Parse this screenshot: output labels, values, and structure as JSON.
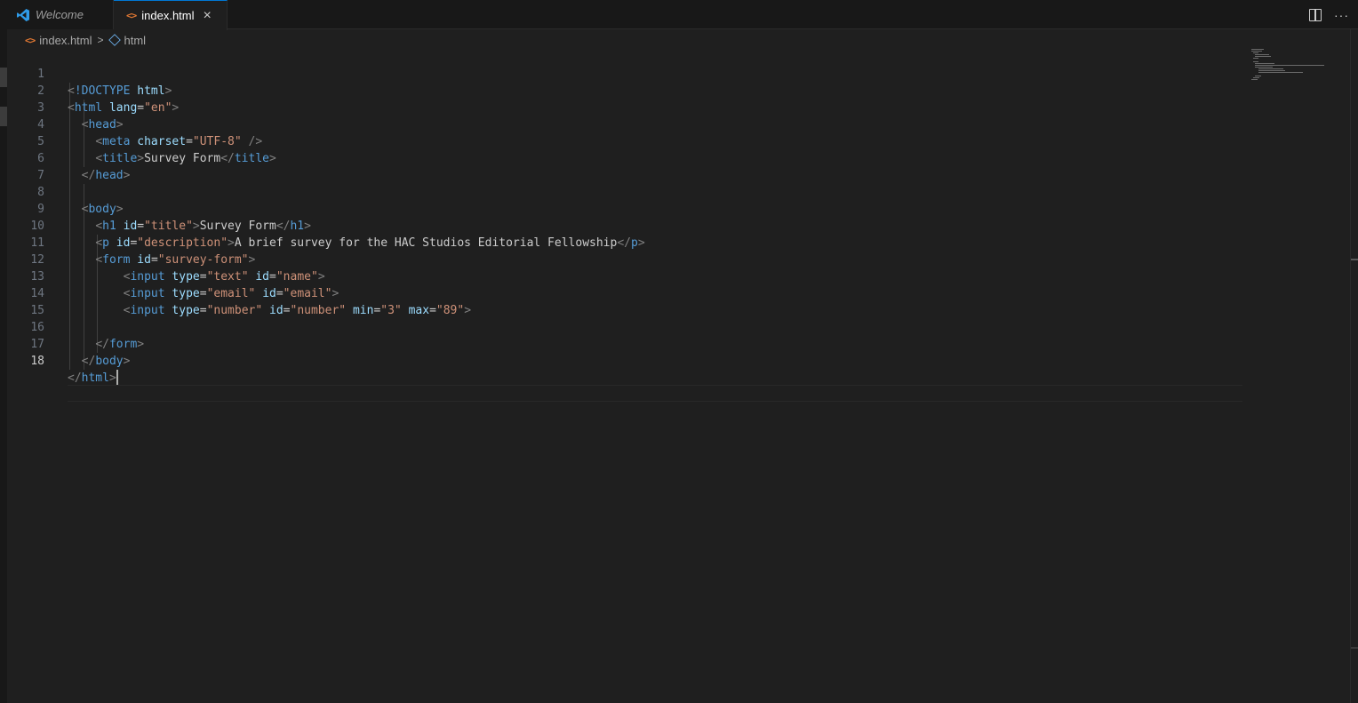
{
  "tabs": {
    "welcome": "Welcome",
    "active": "index.html",
    "close": "×"
  },
  "breadcrumb": {
    "file": "index.html",
    "symbol": "html"
  },
  "code_lines": [
    "<!DOCTYPE html>",
    "<html lang=\"en\">",
    "<head>",
    "<meta charset=\"UTF-8\" />",
    "<title>Survey Form</title>",
    "</head>",
    "",
    "<body>",
    "<h1 id=\"title\">Survey Form</h1>",
    "<p id=\"description\">A brief survey for the HAC Studios Editorial Fellowship</p>",
    "<form id=\"survey-form\">",
    "<input type=\"text\" id=\"name\">",
    "<input type=\"email\" id=\"email\">",
    "<input type=\"number\" id=\"number\" min=\"3\" max=\"89\">",
    "",
    "</form>",
    "</body>",
    "</html>"
  ],
  "line_numbers": [
    "1",
    "2",
    "3",
    "4",
    "5",
    "6",
    "7",
    "8",
    "9",
    "10",
    "11",
    "12",
    "13",
    "14",
    "15",
    "16",
    "17",
    "18"
  ],
  "current_line": "18",
  "icons": {
    "app": "vscode-logo-icon",
    "file": "html-file-icon",
    "symbol": "symbol-element-icon",
    "split": "split-editor-icon",
    "more": "more-actions-icon"
  },
  "colors": {
    "accent": "#0078d4",
    "tag": "#569cd6",
    "attribute": "#9cdcfe",
    "string": "#ce9178",
    "bracket": "#808080",
    "text": "#cccccc"
  }
}
